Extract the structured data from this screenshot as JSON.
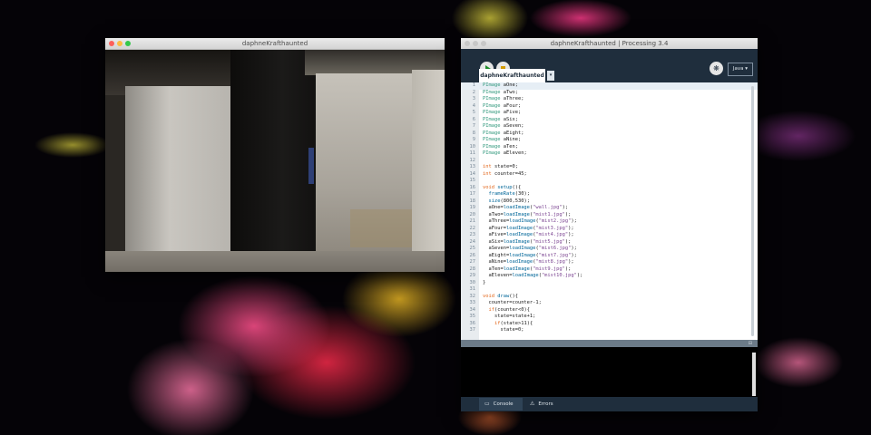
{
  "sketch_window": {
    "title": "daphneKrafthaunted"
  },
  "ide_window": {
    "title": "daphneKrafthaunted | Processing 3.4",
    "mode": "Java ▾",
    "tab_label": "daphneKrafthaunted",
    "tab_menu": "▾",
    "debug_symbol": "❋",
    "console_tab": "Console",
    "errors_tab": "Errors"
  },
  "code_lines": [
    {
      "n": "1",
      "segs": [
        {
          "t": "PImage",
          "c": "ty"
        },
        {
          "t": " aOne;",
          "c": "tx"
        }
      ]
    },
    {
      "n": "2",
      "segs": [
        {
          "t": "PImage",
          "c": "ty"
        },
        {
          "t": " aTwo;",
          "c": "tx"
        }
      ]
    },
    {
      "n": "3",
      "segs": [
        {
          "t": "PImage",
          "c": "ty"
        },
        {
          "t": " aThree;",
          "c": "tx"
        }
      ]
    },
    {
      "n": "4",
      "segs": [
        {
          "t": "PImage",
          "c": "ty"
        },
        {
          "t": " aFour;",
          "c": "tx"
        }
      ]
    },
    {
      "n": "5",
      "segs": [
        {
          "t": "PImage",
          "c": "ty"
        },
        {
          "t": " aFive;",
          "c": "tx"
        }
      ]
    },
    {
      "n": "6",
      "segs": [
        {
          "t": "PImage",
          "c": "ty"
        },
        {
          "t": " aSix;",
          "c": "tx"
        }
      ]
    },
    {
      "n": "7",
      "segs": [
        {
          "t": "PImage",
          "c": "ty"
        },
        {
          "t": " aSeven;",
          "c": "tx"
        }
      ]
    },
    {
      "n": "8",
      "segs": [
        {
          "t": "PImage",
          "c": "ty"
        },
        {
          "t": " aEight;",
          "c": "tx"
        }
      ]
    },
    {
      "n": "9",
      "segs": [
        {
          "t": "PImage",
          "c": "ty"
        },
        {
          "t": " aNine;",
          "c": "tx"
        }
      ]
    },
    {
      "n": "10",
      "segs": [
        {
          "t": "PImage",
          "c": "ty"
        },
        {
          "t": " aTen;",
          "c": "tx"
        }
      ]
    },
    {
      "n": "11",
      "segs": [
        {
          "t": "PImage",
          "c": "ty"
        },
        {
          "t": " aEleven;",
          "c": "tx"
        }
      ]
    },
    {
      "n": "12",
      "segs": []
    },
    {
      "n": "13",
      "segs": [
        {
          "t": "int",
          "c": "kw"
        },
        {
          "t": " state=0;",
          "c": "tx"
        }
      ]
    },
    {
      "n": "14",
      "segs": [
        {
          "t": "int",
          "c": "kw"
        },
        {
          "t": " counter=45;",
          "c": "tx"
        }
      ]
    },
    {
      "n": "15",
      "segs": []
    },
    {
      "n": "16",
      "segs": [
        {
          "t": "void",
          "c": "kw"
        },
        {
          "t": " ",
          "c": "tx"
        },
        {
          "t": "setup",
          "c": "fn"
        },
        {
          "t": "(){",
          "c": "tx"
        }
      ]
    },
    {
      "n": "17",
      "segs": [
        {
          "t": "  ",
          "c": "tx"
        },
        {
          "t": "frameRate",
          "c": "fn"
        },
        {
          "t": "(30);",
          "c": "tx"
        }
      ]
    },
    {
      "n": "18",
      "segs": [
        {
          "t": "  ",
          "c": "tx"
        },
        {
          "t": "size",
          "c": "fn"
        },
        {
          "t": "(800,530);",
          "c": "tx"
        }
      ]
    },
    {
      "n": "19",
      "segs": [
        {
          "t": "  aOne=",
          "c": "tx"
        },
        {
          "t": "loadImage",
          "c": "fn"
        },
        {
          "t": "(",
          "c": "tx"
        },
        {
          "t": "\"wall.jpg\"",
          "c": "st"
        },
        {
          "t": ");",
          "c": "tx"
        }
      ]
    },
    {
      "n": "20",
      "segs": [
        {
          "t": "  aTwo=",
          "c": "tx"
        },
        {
          "t": "loadImage",
          "c": "fn"
        },
        {
          "t": "(",
          "c": "tx"
        },
        {
          "t": "\"mist1.jpg\"",
          "c": "st"
        },
        {
          "t": ");",
          "c": "tx"
        }
      ]
    },
    {
      "n": "21",
      "segs": [
        {
          "t": "  aThree=",
          "c": "tx"
        },
        {
          "t": "loadImage",
          "c": "fn"
        },
        {
          "t": "(",
          "c": "tx"
        },
        {
          "t": "\"mist2.jpg\"",
          "c": "st"
        },
        {
          "t": ");",
          "c": "tx"
        }
      ]
    },
    {
      "n": "22",
      "segs": [
        {
          "t": "  aFour=",
          "c": "tx"
        },
        {
          "t": "loadImage",
          "c": "fn"
        },
        {
          "t": "(",
          "c": "tx"
        },
        {
          "t": "\"mist3.jpg\"",
          "c": "st"
        },
        {
          "t": ");",
          "c": "tx"
        }
      ]
    },
    {
      "n": "23",
      "segs": [
        {
          "t": "  aFive=",
          "c": "tx"
        },
        {
          "t": "loadImage",
          "c": "fn"
        },
        {
          "t": "(",
          "c": "tx"
        },
        {
          "t": "\"mist4.jpg\"",
          "c": "st"
        },
        {
          "t": ");",
          "c": "tx"
        }
      ]
    },
    {
      "n": "24",
      "segs": [
        {
          "t": "  aSix=",
          "c": "tx"
        },
        {
          "t": "loadImage",
          "c": "fn"
        },
        {
          "t": "(",
          "c": "tx"
        },
        {
          "t": "\"mist5.jpg\"",
          "c": "st"
        },
        {
          "t": ");",
          "c": "tx"
        }
      ]
    },
    {
      "n": "25",
      "segs": [
        {
          "t": "  aSeven=",
          "c": "tx"
        },
        {
          "t": "loadImage",
          "c": "fn"
        },
        {
          "t": "(",
          "c": "tx"
        },
        {
          "t": "\"mist6.jpg\"",
          "c": "st"
        },
        {
          "t": ");",
          "c": "tx"
        }
      ]
    },
    {
      "n": "26",
      "segs": [
        {
          "t": "  aEight=",
          "c": "tx"
        },
        {
          "t": "loadImage",
          "c": "fn"
        },
        {
          "t": "(",
          "c": "tx"
        },
        {
          "t": "\"mist7.jpg\"",
          "c": "st"
        },
        {
          "t": ");",
          "c": "tx"
        }
      ]
    },
    {
      "n": "27",
      "segs": [
        {
          "t": "  aNine=",
          "c": "tx"
        },
        {
          "t": "loadImage",
          "c": "fn"
        },
        {
          "t": "(",
          "c": "tx"
        },
        {
          "t": "\"mist8.jpg\"",
          "c": "st"
        },
        {
          "t": ");",
          "c": "tx"
        }
      ]
    },
    {
      "n": "28",
      "segs": [
        {
          "t": "  aTen=",
          "c": "tx"
        },
        {
          "t": "loadImage",
          "c": "fn"
        },
        {
          "t": "(",
          "c": "tx"
        },
        {
          "t": "\"mist9.jpg\"",
          "c": "st"
        },
        {
          "t": ");",
          "c": "tx"
        }
      ]
    },
    {
      "n": "29",
      "segs": [
        {
          "t": "  aEleven=",
          "c": "tx"
        },
        {
          "t": "loadImage",
          "c": "fn"
        },
        {
          "t": "(",
          "c": "tx"
        },
        {
          "t": "\"mist10.jpg\"",
          "c": "st"
        },
        {
          "t": ");",
          "c": "tx"
        }
      ]
    },
    {
      "n": "30",
      "segs": [
        {
          "t": "}",
          "c": "tx"
        }
      ]
    },
    {
      "n": "31",
      "segs": []
    },
    {
      "n": "32",
      "segs": [
        {
          "t": "void",
          "c": "kw"
        },
        {
          "t": " ",
          "c": "tx"
        },
        {
          "t": "draw",
          "c": "fn"
        },
        {
          "t": "(){",
          "c": "tx"
        }
      ]
    },
    {
      "n": "33",
      "segs": [
        {
          "t": "  counter=counter-1;",
          "c": "tx"
        }
      ]
    },
    {
      "n": "34",
      "segs": [
        {
          "t": "  ",
          "c": "tx"
        },
        {
          "t": "if",
          "c": "kw"
        },
        {
          "t": "(counter<0){",
          "c": "tx"
        }
      ]
    },
    {
      "n": "35",
      "segs": [
        {
          "t": "    state=state+1;",
          "c": "tx"
        }
      ]
    },
    {
      "n": "36",
      "segs": [
        {
          "t": "    ",
          "c": "tx"
        },
        {
          "t": "if",
          "c": "kw"
        },
        {
          "t": "(state>11){",
          "c": "tx"
        }
      ]
    },
    {
      "n": "37",
      "segs": [
        {
          "t": "      state=0;",
          "c": "tx"
        }
      ]
    }
  ],
  "colors": {
    "ide_bg": "#1f2e3d",
    "keyword": "#e2661a",
    "type": "#33997e",
    "function": "#006699",
    "string": "#7d4793"
  }
}
